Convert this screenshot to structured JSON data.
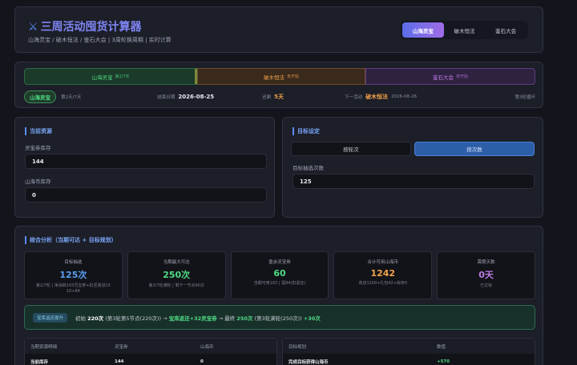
{
  "header": {
    "title": "三周活动囤货计算器",
    "title_icon": "swords-icon",
    "subtitle": "山海灵宝 / 破木恒法 / 鉴石大会 | 3周轮换周期 | 实时计算",
    "tabs": [
      "山海灵宝",
      "破木恒法",
      "鉴石大会"
    ],
    "active_tab": "山海灵宝"
  },
  "timeline": {
    "segments": [
      {
        "label": "山海灵宝",
        "sub": "第2/7天"
      },
      {
        "label": "破木恒法",
        "sub": "未开始"
      },
      {
        "label": "鉴石大会",
        "sub": "未开始"
      }
    ],
    "current_pill": "山海灵宝",
    "day_text": "第2天/7天",
    "end_label": "结束日期",
    "end_date": "2026-08-25",
    "remain_label": "还剩",
    "remain_value": "5天",
    "next_label": "下一活动",
    "next_name": "破木恒法",
    "next_date": "2026-08-26",
    "cycle_text": "第3轮循环"
  },
  "resources": {
    "section_title": "当前资源",
    "field1_label": "灵宝券库存",
    "field1_value": "144",
    "field2_label": "山海币库存",
    "field2_value": "0"
  },
  "goal": {
    "section_title": "目标设定",
    "toggle_a": "按轮次",
    "toggle_b": "按次数",
    "active_toggle": "按次数",
    "field_label": "目标抽选次数",
    "field_value": "125"
  },
  "analysis": {
    "section_title": "综合分析（当期可达 + 目标规划）",
    "cards": [
      {
        "label": "目标抽选",
        "value": "125次",
        "sub": "第2/7轮 | 净消耗103灵宝券+扣至渐进15 10+84",
        "color": "#5aa0f5"
      },
      {
        "label": "当期最大可达",
        "value": "250次",
        "sub": "第3/7轮满轮 | 剩下一节点90次",
        "color": "#4fdb84"
      },
      {
        "label": "盈余灵宝券",
        "value": "60",
        "sub": "当期可用183 | 需84(扣退还)",
        "color": "#4fdb84"
      },
      {
        "label": "合计可用山海币",
        "value": "1242",
        "sub": "商店1200+礼包42+库存0",
        "color": "#f1a24a"
      },
      {
        "label": "需攒天数",
        "value": "0天",
        "sub": "已达标",
        "color": "#c07ae8"
      }
    ],
    "banner": {
      "tag": "宝库返还提升",
      "p1": "初始",
      "v1": "220次",
      "p2": "(第3轮第5节点(220次)) →",
      "v2": "宝库返还+32灵宝券",
      "p3": "→ 最终",
      "v3": "250次",
      "p4": "(第3轮满轮(250次))",
      "v4": "+30次"
    },
    "table1": {
      "headers": [
        "当期资源明细",
        "灵宝券",
        "山海币"
      ],
      "row": [
        "当前库存",
        "144",
        "0"
      ]
    },
    "table2": {
      "headers": [
        "目标规划",
        "数值"
      ],
      "row": [
        "完成目标获得山海币",
        "+570"
      ]
    }
  }
}
